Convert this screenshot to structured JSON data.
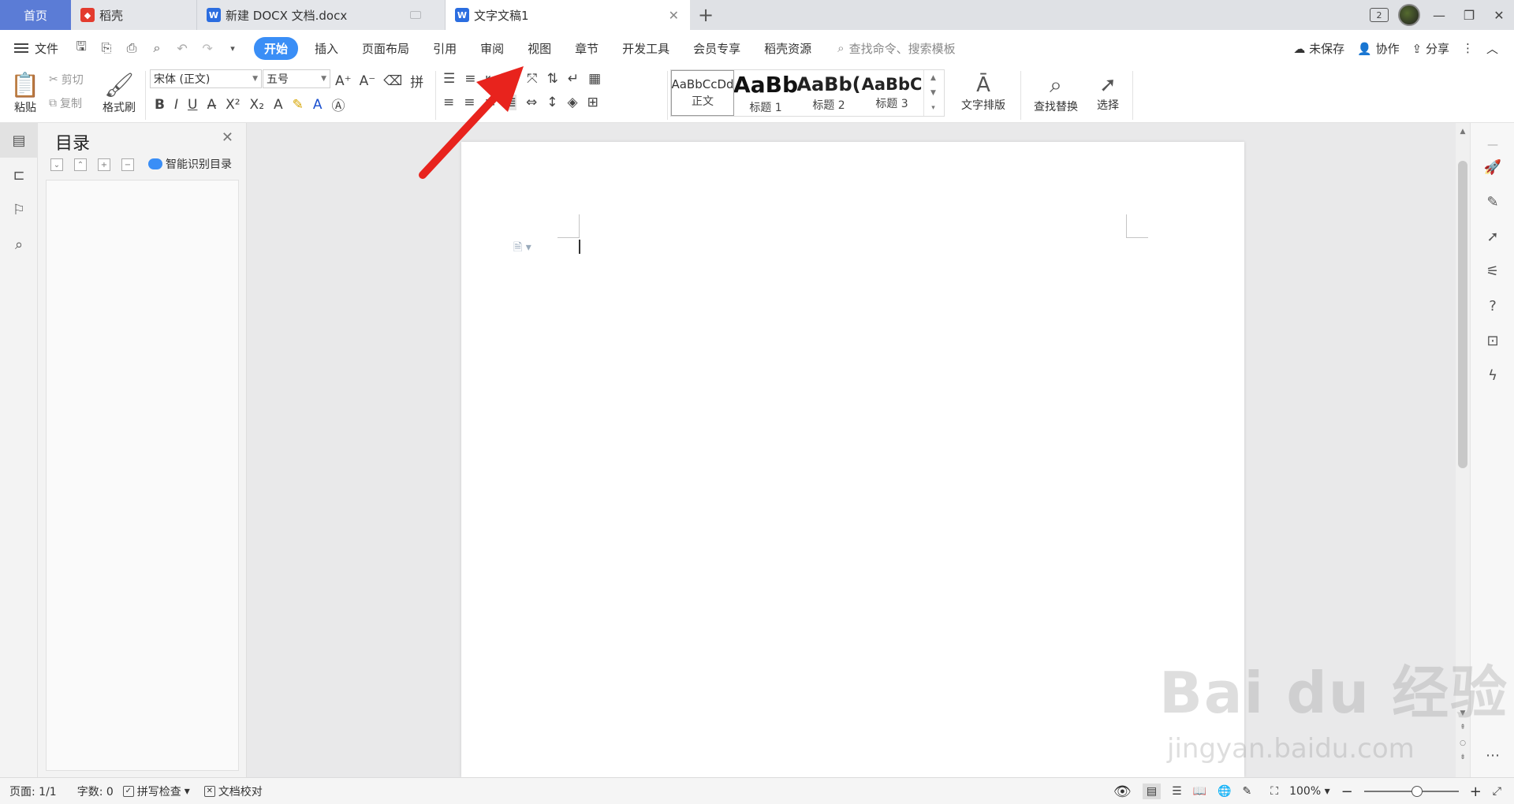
{
  "tabs": [
    {
      "label": "首页"
    },
    {
      "label": "稻壳"
    },
    {
      "label": "新建 DOCX 文档.docx"
    },
    {
      "label": "文字文稿1"
    }
  ],
  "window": {
    "badge": "2"
  },
  "menu": {
    "file": "文件",
    "tabs": [
      "开始",
      "插入",
      "页面布局",
      "引用",
      "审阅",
      "视图",
      "章节",
      "开发工具",
      "会员专享",
      "稻壳资源"
    ],
    "search_placeholder": "查找命令、搜索模板",
    "unsaved": "未保存",
    "collab": "协作",
    "share": "分享"
  },
  "ribbon": {
    "paste": "粘贴",
    "cut": "剪切",
    "copy": "复制",
    "format_painter": "格式刷",
    "font_name": "宋体 (正文)",
    "font_size": "五号",
    "styles": [
      {
        "preview": "AaBbCcDd",
        "name": "正文"
      },
      {
        "preview": "AaBb",
        "name": "标题 1"
      },
      {
        "preview": "AaBb(",
        "name": "标题 2"
      },
      {
        "preview": "AaBbC",
        "name": "标题 3"
      }
    ],
    "text_layout": "文字排版",
    "find_replace": "查找替换",
    "select": "选择"
  },
  "toc": {
    "title": "目录",
    "smart": "智能识别目录"
  },
  "status": {
    "page": "页面: 1/1",
    "words": "字数: 0",
    "spell": "拼写检查",
    "proof": "文档校对",
    "zoom": "100%"
  },
  "watermark": {
    "main": "Bai du 经验",
    "sub": "jingyan.baidu.com"
  },
  "colors": {
    "accent": "#3a8ef6",
    "home_tab": "#5b7cd6",
    "arrow": "#e8231d"
  }
}
